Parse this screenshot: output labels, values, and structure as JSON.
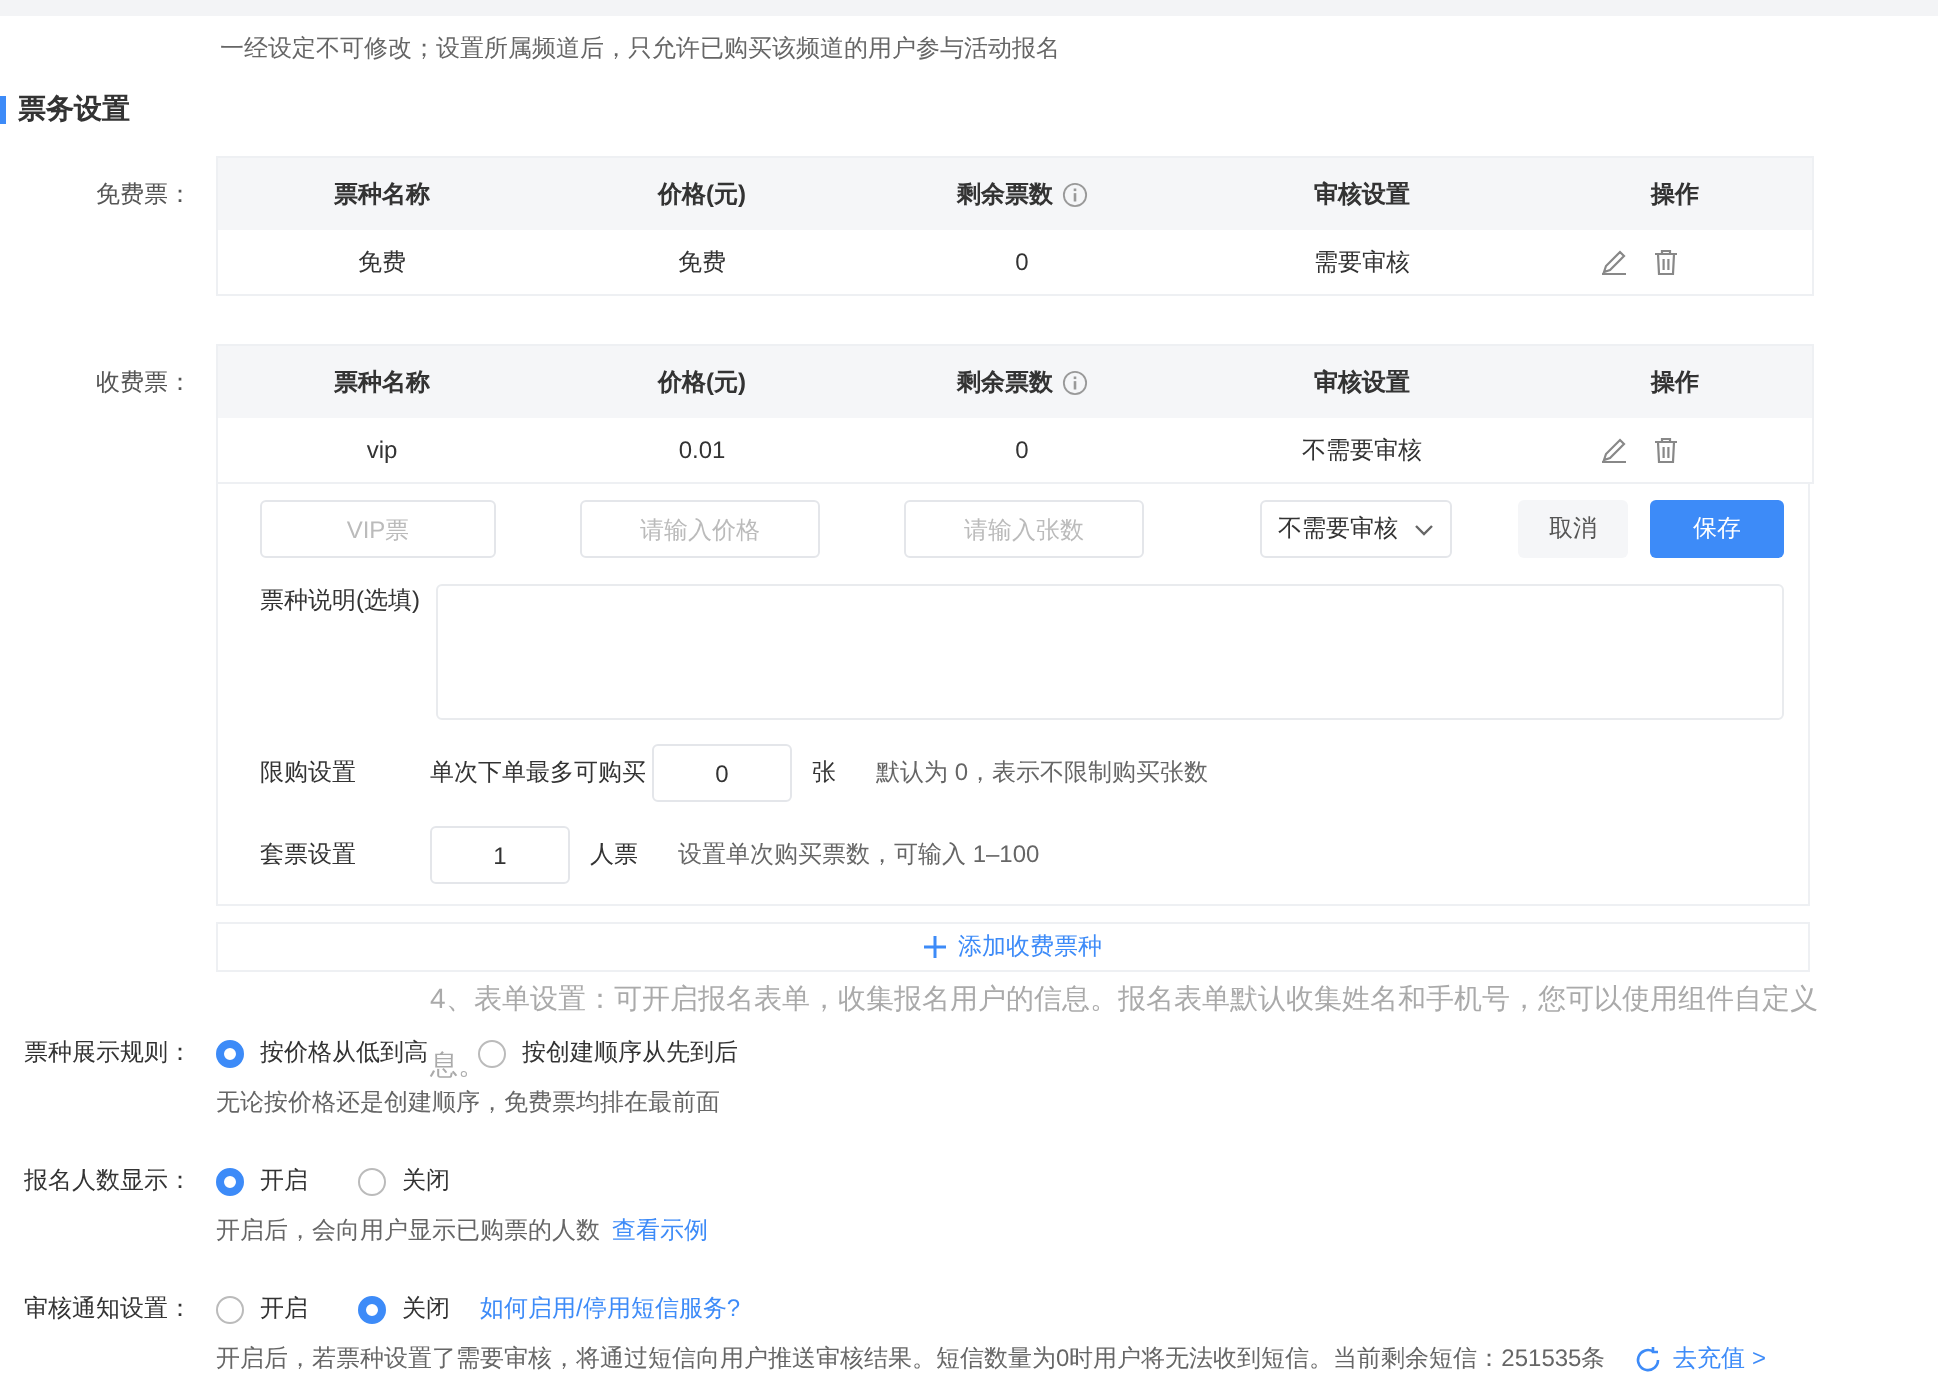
{
  "notice": "一经设定不可修改；设置所属频道后，只允许已购买该频道的用户参与活动报名",
  "section_title": "票务设置",
  "ticket_tables": [
    {
      "label": "免费票：",
      "columns": [
        {
          "title": "票种名称",
          "info": false
        },
        {
          "title": "价格(元)",
          "info": false
        },
        {
          "title": "剩余票数",
          "info": true
        },
        {
          "title": "审核设置",
          "info": false
        },
        {
          "title": "操作",
          "info": false
        }
      ],
      "rows": [
        {
          "name": "免费",
          "price": "免费",
          "remaining": "0",
          "review": "需要审核"
        }
      ]
    },
    {
      "label": "收费票：",
      "columns": [
        {
          "title": "票种名称",
          "info": false
        },
        {
          "title": "价格(元)",
          "info": false
        },
        {
          "title": "剩余票数",
          "info": true
        },
        {
          "title": "审核设置",
          "info": false
        },
        {
          "title": "操作",
          "info": false
        }
      ],
      "rows": [
        {
          "name": "vip",
          "price": "0.01",
          "remaining": "0",
          "review": "不需要审核"
        }
      ]
    }
  ],
  "edit_form": {
    "name_placeholder": "VIP票",
    "price_placeholder": "请输入价格",
    "count_placeholder": "请输入张数",
    "review_select": "不需要审核",
    "cancel": "取消",
    "save": "保存",
    "description_label": "票种说明(选填)",
    "limit": {
      "label": "限购设置",
      "prefix": "单次下单最多可购买",
      "value": "0",
      "unit": "张",
      "hint": "默认为 0，表示不限制购买张数"
    },
    "bundle": {
      "label": "套票设置",
      "value": "1",
      "unit": "人票",
      "hint": "设置单次购买票数，可输入 1–100"
    }
  },
  "add_button": "添加收费票种",
  "overlay_text": [
    "4、表单设置：可开启报名表单，收集报名用户的信息。报名表单默认收集姓名和手机号，您可以使用组件自定义",
    "息。"
  ],
  "settings": [
    {
      "kind": "plain",
      "label": "票种展示规则：",
      "options": [
        {
          "label": "按价格从低到高",
          "selected": true
        },
        {
          "label": "按创建顺序从先到后",
          "selected": false
        }
      ],
      "hint": "无论按价格还是创建顺序，免费票均排在最前面"
    },
    {
      "kind": "example",
      "label": "报名人数显示：",
      "options": [
        {
          "label": "开启",
          "selected": true
        },
        {
          "label": "关闭",
          "selected": false
        }
      ],
      "hint": "开启后，会向用户显示已购票的人数",
      "hint_link": "查看示例"
    },
    {
      "kind": "sms",
      "label": "审核通知设置：",
      "options": [
        {
          "label": "开启",
          "selected": false
        },
        {
          "label": "关闭",
          "selected": true
        }
      ],
      "link": "如何启用/停用短信服务?",
      "hint": "开启后，若票种设置了需要审核，将通过短信向用户推送审核结果。短信数量为0时用户将无法收到短信。当前剩余短信：251535条",
      "hint_link": "去充值 >"
    }
  ]
}
